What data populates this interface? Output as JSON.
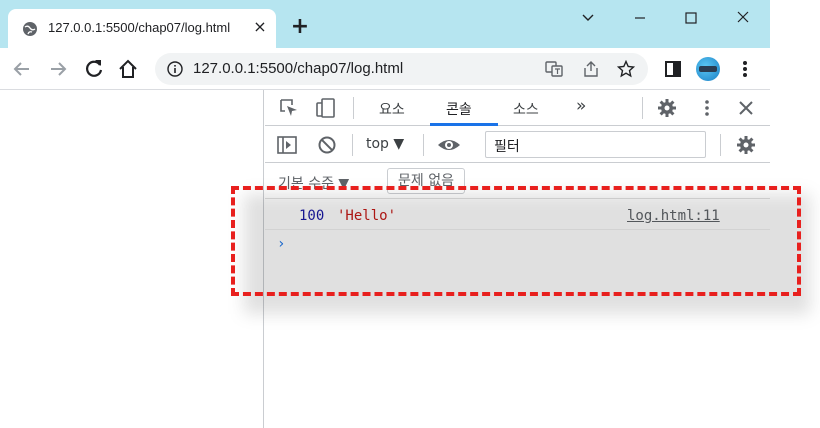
{
  "browser": {
    "tab_title": "127.0.0.1:5500/chap07/log.html",
    "new_tab": "+",
    "close_tab": "×",
    "url": "127.0.0.1:5500/chap07/log.html"
  },
  "devtools": {
    "tabs": [
      "요소",
      "콘솔",
      "소스",
      "»"
    ],
    "active_tab": "콘솔",
    "context": "top ▼",
    "filter_placeholder": "필터",
    "levels": "기본 수준 ▼",
    "issues": "문제 없음"
  },
  "console": {
    "number": "100",
    "string": "'Hello'",
    "source": "log.html:11",
    "prompt": "›"
  },
  "colors": {
    "tabstrip": "#b6e5f0",
    "accent": "#1a73e8",
    "highlight": "#e8201e",
    "number": "#1a1aa6",
    "string": "#c41a16"
  }
}
